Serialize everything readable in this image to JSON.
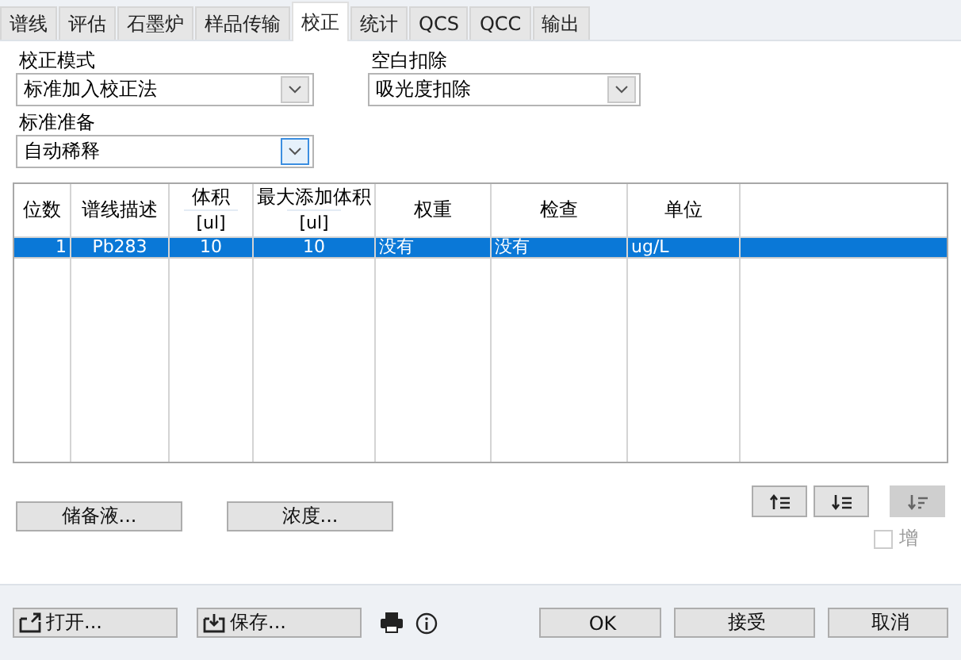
{
  "tabs": [
    {
      "label": "谱线",
      "selected": false
    },
    {
      "label": "评估",
      "selected": false
    },
    {
      "label": "石墨炉",
      "selected": false
    },
    {
      "label": "样品传输",
      "selected": false
    },
    {
      "label": "校正",
      "selected": true
    },
    {
      "label": "统计",
      "selected": false
    },
    {
      "label": "QCS",
      "selected": false
    },
    {
      "label": "QCC",
      "selected": false
    },
    {
      "label": "输出",
      "selected": false
    }
  ],
  "calibration_mode": {
    "label": "校正模式",
    "value": "标准加入校正法",
    "focused": false
  },
  "blank_correction": {
    "label": "空白扣除",
    "value": "吸光度扣除",
    "focused": false
  },
  "standard_preparation": {
    "label": "标准准备",
    "value": "自动稀释",
    "focused": true
  },
  "table": {
    "columns": [
      {
        "label": "位数"
      },
      {
        "label": "谱线描述"
      },
      {
        "label": "体积",
        "unit": "[ul]"
      },
      {
        "label": "最大添加体积",
        "unit": "[ul]"
      },
      {
        "label": "权重"
      },
      {
        "label": "检查"
      },
      {
        "label": "单位"
      }
    ],
    "rows": [
      {
        "cells": [
          "1",
          "Pb283",
          "10",
          "10",
          "没有",
          "没有",
          "ug/L"
        ],
        "selected": true
      }
    ]
  },
  "side_buttons": [
    {
      "label": "储备液..."
    },
    {
      "label": "浓度..."
    }
  ],
  "row_tools": [
    {
      "kind": "up",
      "disabled": false
    },
    {
      "kind": "down",
      "disabled": false
    },
    {
      "kind": "sort",
      "disabled": true
    }
  ],
  "append": {
    "label": "增",
    "checked": false
  },
  "footer": {
    "open": "打开...",
    "save": "保存...",
    "buttons": [
      {
        "label": "OK"
      },
      {
        "label": "接受"
      },
      {
        "label": "取消"
      }
    ]
  }
}
